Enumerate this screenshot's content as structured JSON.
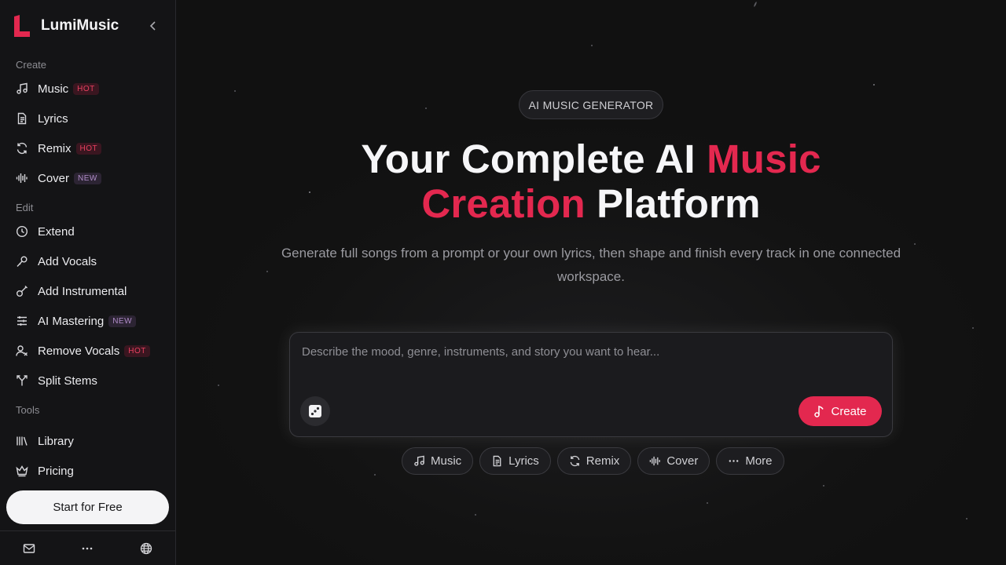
{
  "app": {
    "name": "LumiMusic",
    "brand_color": "#e3284f"
  },
  "sidebar": {
    "sections": {
      "create": "Create",
      "edit": "Edit",
      "tools": "Tools"
    },
    "items": [
      {
        "label": "Music",
        "icon": "music-note-icon",
        "badge": "HOT"
      },
      {
        "label": "Lyrics",
        "icon": "document-icon"
      },
      {
        "label": "Remix",
        "icon": "refresh-icon",
        "badge": "HOT"
      },
      {
        "label": "Cover",
        "icon": "waveform-icon",
        "badge": "NEW"
      },
      {
        "label": "Extend",
        "icon": "clock-icon"
      },
      {
        "label": "Add Vocals",
        "icon": "microphone-icon"
      },
      {
        "label": "Add Instrumental",
        "icon": "guitar-icon"
      },
      {
        "label": "AI Mastering",
        "icon": "sliders-icon",
        "badge": "NEW"
      },
      {
        "label": "Remove Vocals",
        "icon": "user-remove-icon",
        "badge": "HOT"
      },
      {
        "label": "Split Stems",
        "icon": "split-icon"
      },
      {
        "label": "Library",
        "icon": "library-icon"
      },
      {
        "label": "Pricing",
        "icon": "crown-icon"
      }
    ],
    "cta_label": "Start for Free",
    "footer_icons": [
      "mail-icon",
      "more-icon",
      "globe-icon"
    ]
  },
  "hero": {
    "pill": "AI MUSIC GENERATOR",
    "headline_part1": "Your Complete AI ",
    "headline_accent": "Music Creation",
    "headline_part2": " Platform",
    "subtitle": "Generate full songs from a prompt or your own lyrics, then shape and finish every track in one connected workspace."
  },
  "composer": {
    "placeholder": "Describe the mood, genre, instruments, and story you want to hear...",
    "create_label": "Create"
  },
  "chips": [
    {
      "label": "Music",
      "icon": "music-note-icon"
    },
    {
      "label": "Lyrics",
      "icon": "document-icon"
    },
    {
      "label": "Remix",
      "icon": "refresh-icon"
    },
    {
      "label": "Cover",
      "icon": "waveform-icon"
    },
    {
      "label": "More",
      "icon": "more-icon"
    }
  ]
}
